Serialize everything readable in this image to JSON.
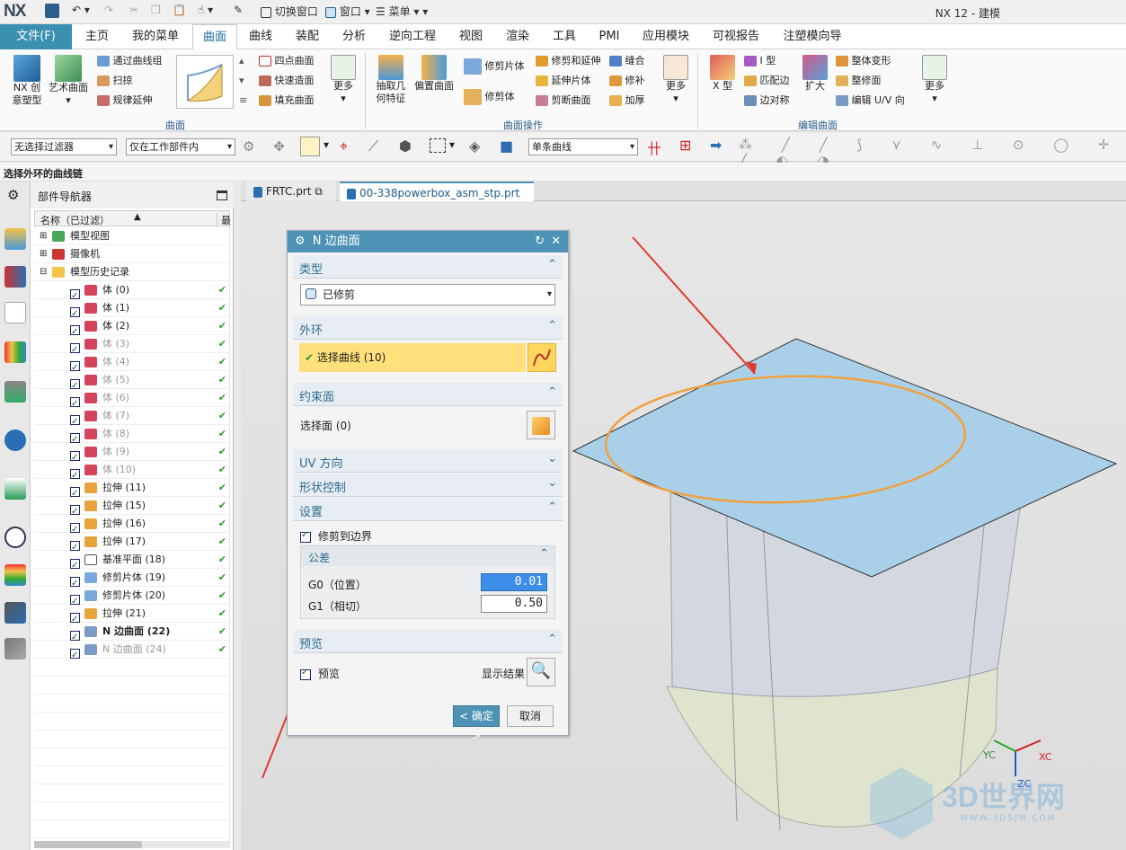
{
  "titlebar": {
    "logo": "NX",
    "switch_window": "切换窗口",
    "window": "窗口",
    "menu": "菜单",
    "title": "NX 12 - 建模"
  },
  "menubar": {
    "file": "文件(F)",
    "tabs": [
      "主页",
      "我的菜单",
      "曲面",
      "曲线",
      "装配",
      "分析",
      "逆向工程",
      "视图",
      "渲染",
      "工具",
      "PMI",
      "应用模块",
      "可视报告",
      "注塑模向导"
    ]
  },
  "ribbon": {
    "nx_creative": "NX 创\n意塑型",
    "art_surface": "艺术曲面",
    "through_curves": "通过曲线组",
    "sweep": "扫掠",
    "ruled_ext": "规律延伸",
    "four_point": "四点曲面",
    "quick_surface": "快速造面",
    "fill_surface": "填充曲面",
    "more1": "更多",
    "extract": "抽取几\n何特征",
    "offset_surface": "偏置曲面",
    "trim_body": "修剪片体",
    "trim_sheet": "修剪体",
    "trim_extend": "修剪和延伸",
    "extend_sheet": "延伸片体",
    "divide_face": "剪断曲面",
    "sew": "缝合",
    "patch": "修补",
    "thicken": "加厚",
    "more2": "更多",
    "x_type": "X 型",
    "i_type": "I 型",
    "match_edge": "匹配边",
    "edge_symmetry": "边对称",
    "enlarge": "扩大",
    "global_shape": "整体变形",
    "repair": "整修面",
    "edit_uv": "编辑 U/V 向",
    "more3": "更多",
    "group_surface": "曲面",
    "group_ops": "曲面操作",
    "group_edit": "编辑曲面"
  },
  "toolbar": {
    "filter": "无选择过滤器",
    "scope": "仅在工作部件内",
    "curve_rule": "单条曲线"
  },
  "status": "选择外环的曲线链",
  "navigator": {
    "title": "部件导航器",
    "col_name": "名称（已过滤）",
    "col_latest": "最",
    "rows": [
      {
        "label": "模型视图",
        "level": 0,
        "gray": false,
        "tick": false,
        "box": false
      },
      {
        "label": "摄像机",
        "level": 0,
        "gray": false,
        "tick": false,
        "box": false
      },
      {
        "label": "模型历史记录",
        "level": 0,
        "gray": false,
        "tick": false,
        "box": false
      },
      {
        "label": "体 (0)",
        "level": 1,
        "gray": false,
        "tick": true,
        "box": true
      },
      {
        "label": "体 (1)",
        "level": 1,
        "gray": false,
        "tick": true,
        "box": true
      },
      {
        "label": "体 (2)",
        "level": 1,
        "gray": false,
        "tick": true,
        "box": true
      },
      {
        "label": "体 (3)",
        "level": 1,
        "gray": true,
        "tick": true,
        "box": true
      },
      {
        "label": "体 (4)",
        "level": 1,
        "gray": true,
        "tick": true,
        "box": true
      },
      {
        "label": "体 (5)",
        "level": 1,
        "gray": true,
        "tick": true,
        "box": true
      },
      {
        "label": "体 (6)",
        "level": 1,
        "gray": true,
        "tick": true,
        "box": true
      },
      {
        "label": "体 (7)",
        "level": 1,
        "gray": true,
        "tick": true,
        "box": true
      },
      {
        "label": "体 (8)",
        "level": 1,
        "gray": true,
        "tick": true,
        "box": true
      },
      {
        "label": "体 (9)",
        "level": 1,
        "gray": true,
        "tick": true,
        "box": true
      },
      {
        "label": "体 (10)",
        "level": 1,
        "gray": true,
        "tick": true,
        "box": true
      },
      {
        "label": "拉伸 (11)",
        "level": 1,
        "gray": false,
        "tick": true,
        "box": true
      },
      {
        "label": "拉伸 (15)",
        "level": 1,
        "gray": false,
        "tick": true,
        "box": true
      },
      {
        "label": "拉伸 (16)",
        "level": 1,
        "gray": false,
        "tick": true,
        "box": true
      },
      {
        "label": "拉伸 (17)",
        "level": 1,
        "gray": false,
        "tick": true,
        "box": true
      },
      {
        "label": "基准平面 (18)",
        "level": 1,
        "gray": false,
        "tick": true,
        "box": true
      },
      {
        "label": "修剪片体 (19)",
        "level": 1,
        "gray": false,
        "tick": true,
        "box": true
      },
      {
        "label": "修剪片体 (20)",
        "level": 1,
        "gray": false,
        "tick": true,
        "box": true
      },
      {
        "label": "拉伸 (21)",
        "level": 1,
        "gray": false,
        "tick": true,
        "box": true
      },
      {
        "label": "N 边曲面 (22)",
        "level": 1,
        "gray": false,
        "tick": true,
        "box": true,
        "bold": true
      },
      {
        "label": "N 边曲面 (24)",
        "level": 1,
        "gray": true,
        "tick": true,
        "box": true
      }
    ]
  },
  "tabs": [
    {
      "label": "FRTC.prt"
    },
    {
      "label": "00-338powerbox_asm_stp.prt"
    }
  ],
  "dialog": {
    "title": "N 边曲面",
    "type_section": "类型",
    "type_value": "已修剪",
    "outer_loop": "外环",
    "select_curve": "选择曲线 (10)",
    "constraint": "约束面",
    "select_face": "选择面 (0)",
    "uv": "UV 方向",
    "shape": "形状控制",
    "settings": "设置",
    "trim_to_boundary": "修剪到边界",
    "tolerance": "公差",
    "g0": "G0（位置）",
    "g0_value": "0.01",
    "g1": "G1（相切）",
    "g1_value": "0.50",
    "preview_section": "预览",
    "preview": "预览",
    "show_result": "显示结果",
    "ok": "< 确定 >",
    "cancel": "取消"
  },
  "viewport": {
    "yc": "YC",
    "xc": "XC",
    "zc": "ZC",
    "watermark": "3D世界网",
    "watermark_url": "WWW.3DSJW.COM"
  },
  "colors": {
    "accent": "#4e93b5",
    "highlight": "#ffe07a",
    "sheet": "#a9d0e8",
    "curve": "#f0a040",
    "arrow": "#e23b2e"
  }
}
